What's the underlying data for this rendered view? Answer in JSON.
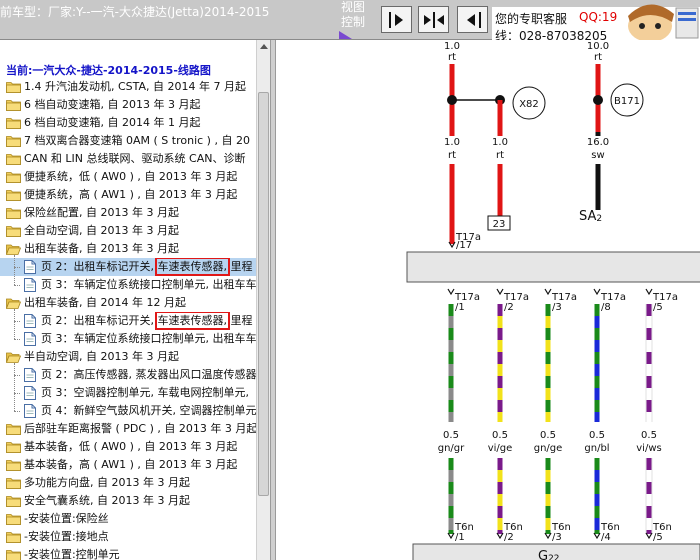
{
  "header": {
    "vehicle_title": "前车型：厂家:Y--一汽-大众捷达(Jetta)2014-2015",
    "view_control_label": "视图\n控制",
    "nav_buttons": [
      {
        "id": "next",
        "icon": "arrow-right-icon"
      },
      {
        "id": "fit",
        "icon": "arrows-inward-icon"
      },
      {
        "id": "prev",
        "icon": "arrow-left-icon"
      }
    ],
    "service": {
      "label": "您的专职客服",
      "qq": "QQ:19",
      "phone": "线：028-87038205"
    }
  },
  "tree": {
    "current": "当前:一汽大众-捷达-2014-2015-线路图",
    "highlight_term": "车速表传感器,",
    "items": [
      {
        "level": 0,
        "icon": "folder-icon",
        "label": "1.4 升汽油发动机, CSTA, 自 2014 年 7 月起"
      },
      {
        "level": 0,
        "icon": "folder-icon",
        "label": "6 档自动变速箱, 自 2013 年 3 月起"
      },
      {
        "level": 0,
        "icon": "folder-icon",
        "label": "6 档自动变速箱, 自 2014 年 1 月起"
      },
      {
        "level": 0,
        "icon": "folder-icon",
        "label": "7 档双离合器变速箱 0AM ( S tronic ) , 自 20"
      },
      {
        "level": 0,
        "icon": "folder-icon",
        "label": "CAN 和 LIN 总线联网、驱动系统 CAN、诊断"
      },
      {
        "level": 0,
        "icon": "folder-icon",
        "label": "便捷系统，低 ( AW0 ) , 自 2013 年 3 月起"
      },
      {
        "level": 0,
        "icon": "folder-icon",
        "label": "便捷系统，高 ( AW1 ) , 自 2013 年 3 月起"
      },
      {
        "level": 0,
        "icon": "folder-icon",
        "label": "保险丝配置, 自 2013 年 3 月起"
      },
      {
        "level": 0,
        "icon": "folder-icon",
        "label": "全自动空调, 自 2013 年 3 月起"
      },
      {
        "level": 0,
        "icon": "folder-open-icon",
        "label": "出租车装备, 自 2013 年 3 月起"
      },
      {
        "level": 1,
        "icon": "document-icon",
        "label": "页 2：出租车标记开关, ",
        "highlight": "车速表传感器,",
        "suffix": " 里程",
        "selected": true
      },
      {
        "level": 1,
        "icon": "document-icon",
        "label": "页 3：车辆定位系统接口控制单元, 出租车车"
      },
      {
        "level": 0,
        "icon": "folder-open-icon",
        "label": "出租车装备, 自 2014 年 12 月起"
      },
      {
        "level": 1,
        "icon": "document-icon",
        "label": "页 2：出租车标记开关, ",
        "highlight": "车速表传感器,",
        "suffix": " 里程"
      },
      {
        "level": 1,
        "icon": "document-icon",
        "label": "页 3：车辆定位系统接口控制单元, 出租车车"
      },
      {
        "level": 0,
        "icon": "folder-open-icon",
        "label": "半自动空调, 自 2013 年 3 月起"
      },
      {
        "level": 1,
        "icon": "document-icon",
        "label": "页 2：高压传感器, 蒸发器出风口温度传感器"
      },
      {
        "level": 1,
        "icon": "document-icon",
        "label": "页 3：空调器控制单元, 车载电网控制单元,"
      },
      {
        "level": 1,
        "icon": "document-icon",
        "label": "页 4：新鲜空气鼓风机开关, 空调器控制单元"
      },
      {
        "level": 0,
        "icon": "folder-icon",
        "label": "后部驻车距离报警 ( PDC ) , 自 2013 年 3 月起"
      },
      {
        "level": 0,
        "icon": "folder-icon",
        "label": "基本装备，低 ( AW0 ) , 自 2013 年 3 月起"
      },
      {
        "level": 0,
        "icon": "folder-icon",
        "label": "基本装备，高 ( AW1 ) , 自 2013 年 3 月起"
      },
      {
        "level": 0,
        "icon": "folder-icon",
        "label": "多功能方向盘, 自 2013 年 3 月起"
      },
      {
        "level": 0,
        "icon": "folder-icon",
        "label": "安全气囊系统, 自 2013 年 3 月起"
      },
      {
        "level": 0,
        "icon": "folder-icon",
        "label": "-安装位置:保险丝"
      },
      {
        "level": 0,
        "icon": "folder-icon",
        "label": "-安装位置:接地点"
      },
      {
        "level": 0,
        "icon": "folder-icon",
        "label": "-安装位置:控制单元"
      }
    ]
  },
  "diagram": {
    "top_wires": [
      {
        "id": "w1",
        "size": "1.0",
        "color_code": "rt",
        "colors": [
          "#e01515"
        ]
      },
      {
        "id": "w3",
        "size": "10.0",
        "color_code": "rt",
        "colors": [
          "#e01515"
        ]
      }
    ],
    "middle_wires": [
      {
        "id": "w1b",
        "size": "1.0",
        "color_code": "rt",
        "colors": [
          "#e01515"
        ]
      },
      {
        "id": "w2b",
        "size": "1.0",
        "color_code": "rt",
        "colors": [
          "#e01515"
        ]
      },
      {
        "id": "w3b",
        "size": "16.0",
        "color_code": "sw",
        "colors": [
          "#111111"
        ]
      }
    ],
    "splice_labels": [
      "X82",
      "B171"
    ],
    "ground_label": "SA2",
    "ground_label_main": "SA",
    "ground_label_sub": "2",
    "box_pin_label": "23",
    "top_connector_pin": {
      "connector": "T17a",
      "pin": "/17"
    },
    "bottom_wires": [
      {
        "connector": "T17a",
        "pin": "/1",
        "size": "0.5",
        "color_code": "gn/gr",
        "colors": [
          "#1a8a1a",
          "#8a8a8a"
        ],
        "bottom_connector": "T6n",
        "bottom_pin": "/1"
      },
      {
        "connector": "T17a",
        "pin": "/2",
        "size": "0.5",
        "color_code": "vi/ge",
        "colors": [
          "#7a1a8a",
          "#f2e21a"
        ],
        "bottom_connector": "T6n",
        "bottom_pin": "/2"
      },
      {
        "connector": "T17a",
        "pin": "/3",
        "size": "0.5",
        "color_code": "gn/ge",
        "colors": [
          "#1a8a1a",
          "#f2e21a"
        ],
        "bottom_connector": "T6n",
        "bottom_pin": "/3"
      },
      {
        "connector": "T17a",
        "pin": "/8",
        "size": "0.5",
        "color_code": "gn/bl",
        "colors": [
          "#1a8a1a",
          "#1a2ad8"
        ],
        "bottom_connector": "T6n",
        "bottom_pin": "/4"
      },
      {
        "connector": "T17a",
        "pin": "/5",
        "size": "0.5",
        "color_code": "vi/ws",
        "colors": [
          "#7a1a8a",
          "#ffffff"
        ],
        "bottom_connector": "T6n",
        "bottom_pin": "/5"
      }
    ],
    "bottom_component": "G22",
    "bottom_component_main": "G",
    "bottom_component_sub": "22"
  }
}
